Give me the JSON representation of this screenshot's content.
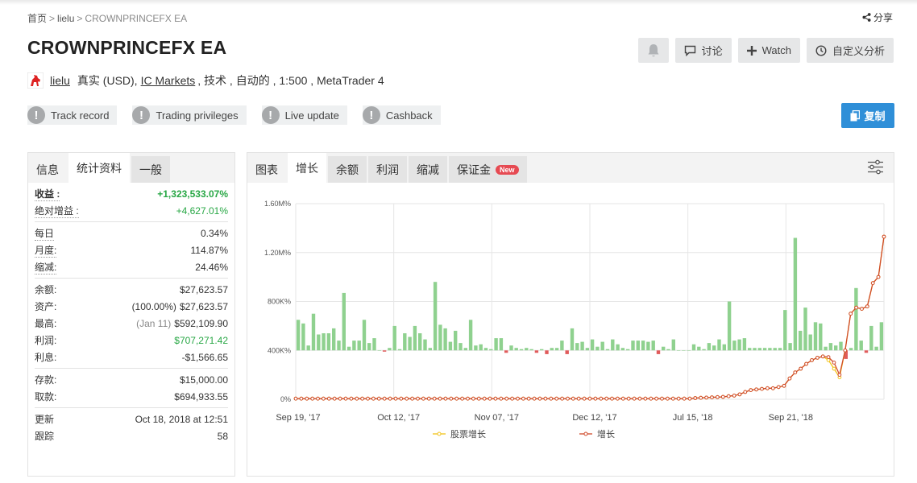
{
  "breadcrumb": {
    "home": "首页",
    "user": "lielu",
    "current": "CROWNPRINCEFX EA"
  },
  "share": "分享",
  "title": "CROWNPRINCEFX EA",
  "actions": {
    "discuss": "讨论",
    "watch": "Watch",
    "custom": "自定义分析"
  },
  "meta": {
    "user": "lielu",
    "account": "真实 (USD),",
    "broker": "IC Markets",
    "rest": ", 技术 , 自动的 , 1:500 , MetaTrader 4"
  },
  "badges": [
    "Track record",
    "Trading privileges",
    "Live update",
    "Cashback"
  ],
  "copy_button": "复制",
  "left_tabs": [
    "信息",
    "统计资料",
    "一般"
  ],
  "stats": {
    "gain_label": "收益 :",
    "gain": "+1,323,533.07%",
    "abs_label": "绝对增益 :",
    "abs": "+4,627.01%",
    "daily_label": "每日",
    "daily": "0.34%",
    "monthly_label": "月度:",
    "monthly": "114.87%",
    "drawdown_label": "缩减:",
    "drawdown": "24.46%",
    "balance_label": "余额:",
    "balance": "$27,623.57",
    "equity_label": "资产:",
    "equity_pct": "(100.00%)",
    "equity": "$27,623.57",
    "highest_label": "最高:",
    "highest_date": "(Jan 11)",
    "highest": "$592,109.90",
    "profit_label": "利润:",
    "profit": "$707,271.42",
    "interest_label": "利息:",
    "interest": "-$1,566.65",
    "deposits_label": "存款:",
    "deposits": "$15,000.00",
    "withdrawals_label": "取款:",
    "withdrawals": "$694,933.55",
    "updated_label": "更新",
    "updated": "Oct 18, 2018 at 12:51",
    "tracking_label": "跟踪",
    "tracking": "58"
  },
  "right_tabs": [
    "图表",
    "增长",
    "余额",
    "利润",
    "缩减",
    "保证金"
  ],
  "new_badge": "New",
  "colors": {
    "growth_line": "#cf4a2b",
    "equity_line": "#f2c31a",
    "bar_positive": "#8fd18f",
    "bar_negative": "#e05b5b",
    "accent": "#2f8fd8"
  },
  "chart_data": {
    "type": "bar+line",
    "y_ticks": [
      "1.60M%",
      "1.20M%",
      "800K%",
      "400K%",
      "0%"
    ],
    "ylim": [
      0,
      1600000
    ],
    "x_ticks": [
      "Sep 19, '17",
      "Oct 12, '17",
      "Nov 07, '17",
      "Dec 12, '17",
      "Jul 15, '18",
      "Sep 21, '18"
    ],
    "legend": [
      "股票增长",
      "增长"
    ],
    "legend_placement": "bottom",
    "grid": true,
    "bar_baseline": 400000,
    "bars": [
      650000,
      620000,
      440000,
      700000,
      530000,
      540000,
      540000,
      580000,
      480000,
      870000,
      430000,
      480000,
      480000,
      650000,
      460000,
      500000,
      400000,
      390000,
      420000,
      600000,
      410000,
      540000,
      510000,
      600000,
      540000,
      490000,
      420000,
      960000,
      610000,
      580000,
      470000,
      560000,
      460000,
      420000,
      650000,
      440000,
      450000,
      420000,
      410000,
      500000,
      500000,
      380000,
      440000,
      420000,
      410000,
      420000,
      410000,
      380000,
      410000,
      370000,
      420000,
      420000,
      480000,
      370000,
      580000,
      460000,
      470000,
      420000,
      490000,
      430000,
      470000,
      410000,
      490000,
      450000,
      420000,
      410000,
      480000,
      480000,
      480000,
      470000,
      480000,
      370000,
      430000,
      410000,
      490000,
      400000,
      400000,
      400000,
      450000,
      430000,
      410000,
      460000,
      440000,
      490000,
      450000,
      800000,
      480000,
      490000,
      500000,
      420000,
      420000,
      420000,
      420000,
      420000,
      420000,
      420000,
      730000,
      460000,
      1320000,
      560000,
      750000,
      530000,
      630000,
      620000,
      430000,
      460000,
      440000,
      470000,
      330000,
      420000,
      910000,
      480000,
      380000,
      600000,
      430000,
      630000
    ],
    "growth": [
      5000,
      5000,
      5000,
      5000,
      5000,
      5000,
      5000,
      5000,
      5000,
      5000,
      5000,
      5000,
      5000,
      5000,
      5000,
      5000,
      5000,
      5000,
      5000,
      5000,
      5000,
      5000,
      5000,
      5000,
      5000,
      5000,
      5000,
      5000,
      5000,
      5000,
      5000,
      5000,
      5000,
      5000,
      5000,
      5000,
      5000,
      5000,
      5000,
      5000,
      5000,
      5000,
      5000,
      5000,
      5000,
      5000,
      5000,
      5000,
      5000,
      5000,
      5000,
      5000,
      5000,
      5000,
      5000,
      5000,
      5000,
      5000,
      5000,
      5000,
      5000,
      5000,
      5000,
      5000,
      5000,
      5000,
      5000,
      5000,
      5000,
      5000,
      5000,
      5000,
      10000,
      12000,
      14000,
      16000,
      18000,
      20000,
      25000,
      30000,
      40000,
      60000,
      75000,
      80000,
      85000,
      90000,
      90000,
      100000,
      110000,
      170000,
      220000,
      250000,
      290000,
      320000,
      340000,
      350000,
      345000,
      300000,
      200000,
      400000,
      700000,
      750000,
      740000,
      760000,
      950000,
      1000000,
      1330000
    ],
    "equity_growth": [
      5000,
      5000,
      5000,
      5000,
      5000,
      5000,
      5000,
      5000,
      5000,
      5000,
      5000,
      5000,
      5000,
      5000,
      5000,
      5000,
      5000,
      5000,
      5000,
      5000,
      5000,
      5000,
      5000,
      5000,
      5000,
      5000,
      5000,
      5000,
      5000,
      5000,
      5000,
      5000,
      5000,
      5000,
      5000,
      5000,
      5000,
      5000,
      5000,
      5000,
      5000,
      5000,
      5000,
      5000,
      5000,
      5000,
      5000,
      5000,
      5000,
      5000,
      5000,
      5000,
      5000,
      5000,
      5000,
      5000,
      5000,
      5000,
      5000,
      5000,
      5000,
      5000,
      5000,
      5000,
      5000,
      5000,
      5000,
      5000,
      5000,
      5000,
      5000,
      5000,
      10000,
      12000,
      14000,
      16000,
      18000,
      20000,
      25000,
      30000,
      40000,
      60000,
      75000,
      80000,
      85000,
      90000,
      90000,
      100000,
      110000,
      170000,
      220000,
      250000,
      290000,
      320000,
      340000,
      350000,
      320000,
      250000,
      180000,
      400000,
      700000,
      750000,
      740000,
      760000,
      950000,
      1000000,
      1330000
    ]
  }
}
